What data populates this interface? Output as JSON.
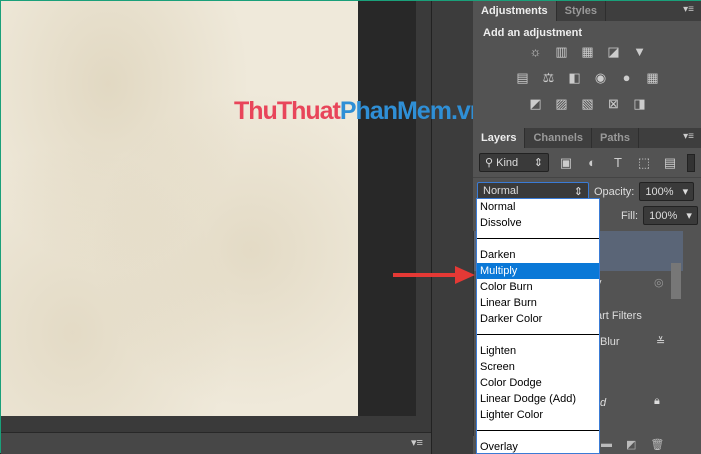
{
  "watermark": {
    "part1": "ThuThuat",
    "part2": "PhanMem",
    "part3": ".vn"
  },
  "adjustments": {
    "tabs": [
      "Adjustments",
      "Styles"
    ],
    "heading": "Add an adjustment",
    "row1": [
      "brightness-contrast-icon",
      "levels-icon",
      "curves-icon",
      "exposure-icon",
      "vibrance-icon"
    ],
    "row2": [
      "hue-saturation-icon",
      "color-balance-icon",
      "black-white-icon",
      "photo-filter-icon",
      "channel-mixer-icon",
      "color-lookup-icon"
    ],
    "row3": [
      "invert-icon",
      "posterize-icon",
      "threshold-icon",
      "selective-color-icon",
      "gradient-map-icon"
    ]
  },
  "layers": {
    "tabs": [
      "Layers",
      "Channels",
      "Paths"
    ],
    "filter_kind": "Kind",
    "blend_mode": "Normal",
    "opacity_label": "Opacity:",
    "opacity": "100%",
    "fill_label": "Fill:",
    "fill": "100%",
    "partial": {
      "layer_suffix": "y",
      "smart_filters": "art Filters",
      "blur": "Blur",
      "locked_suffix": "d"
    }
  },
  "blend_menu": {
    "groups": [
      [
        "Normal",
        "Dissolve"
      ],
      [
        "Darken",
        "Multiply",
        "Color Burn",
        "Linear Burn",
        "Darker Color"
      ],
      [
        "Lighten",
        "Screen",
        "Color Dodge",
        "Linear Dodge (Add)",
        "Lighter Color"
      ],
      [
        "Overlay"
      ]
    ],
    "selected": "Multiply"
  },
  "colors": {
    "arrow": "#e53935",
    "selection": "#0a78d7"
  }
}
